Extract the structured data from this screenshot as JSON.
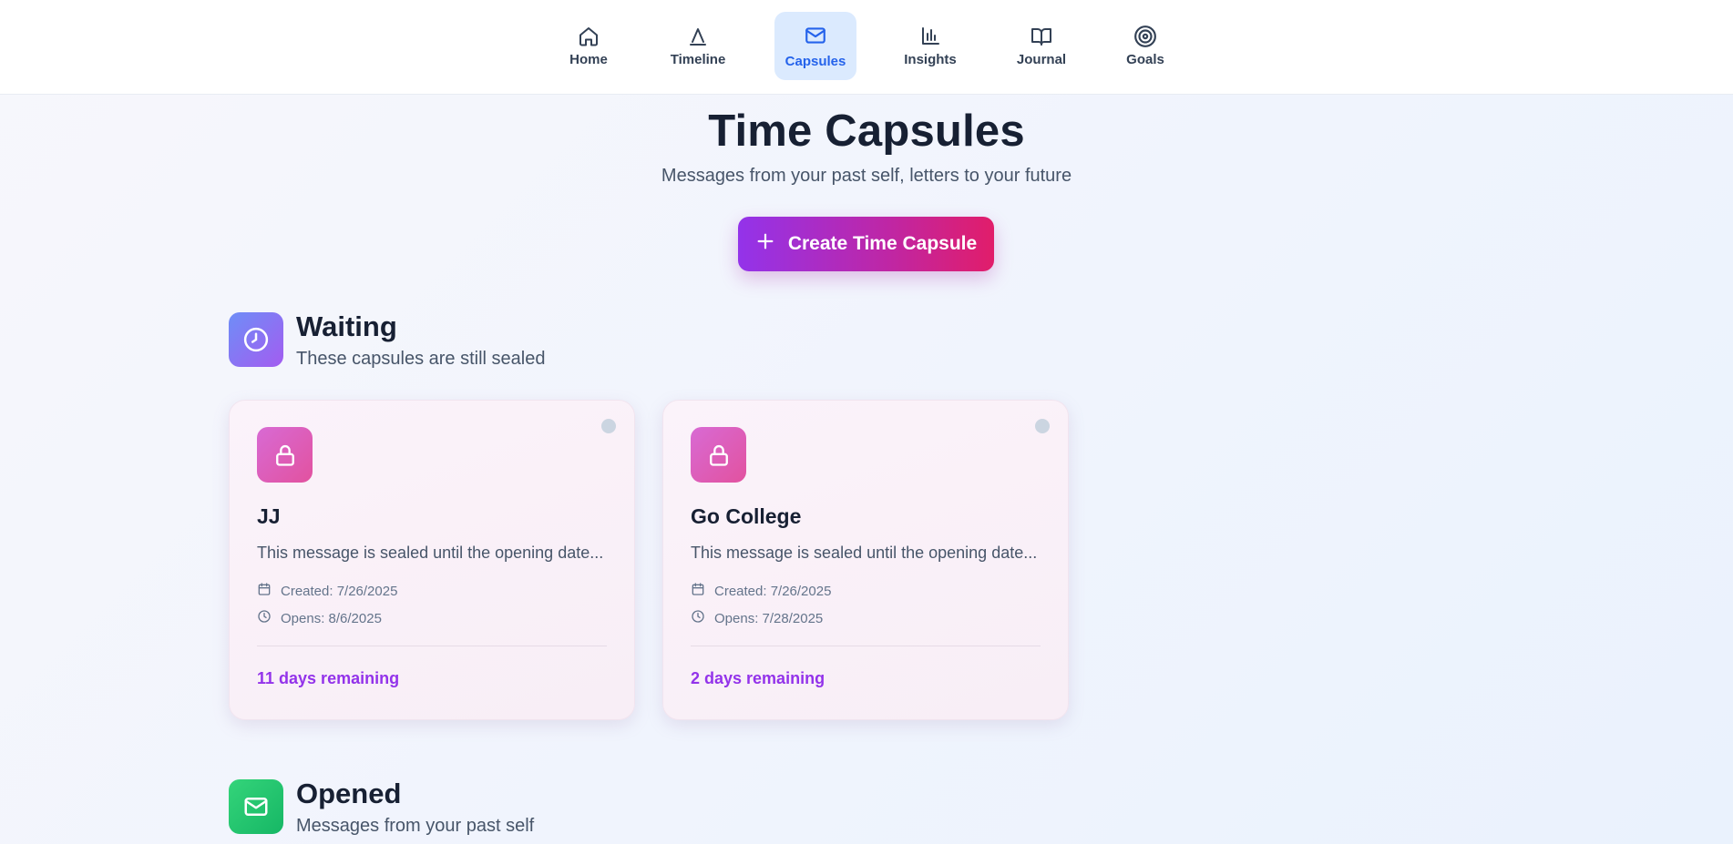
{
  "nav": {
    "items": [
      {
        "label": "Home",
        "icon": "home-icon"
      },
      {
        "label": "Timeline",
        "icon": "timeline-icon"
      },
      {
        "label": "Capsules",
        "icon": "mail-icon",
        "active": true
      },
      {
        "label": "Insights",
        "icon": "bar-chart-icon"
      },
      {
        "label": "Journal",
        "icon": "book-open-icon"
      },
      {
        "label": "Goals",
        "icon": "target-icon"
      }
    ]
  },
  "header": {
    "title": "Time Capsules",
    "subtitle": "Messages from your past self, letters to your future",
    "create_label": "Create Time Capsule"
  },
  "waiting": {
    "title": "Waiting",
    "subtitle": "These capsules are still sealed",
    "capsules": [
      {
        "title": "JJ",
        "message": "This message is sealed until the opening date...",
        "created": "Created: 7/26/2025",
        "opens": "Opens: 8/6/2025",
        "remaining": "11 days remaining"
      },
      {
        "title": "Go College",
        "message": "This message is sealed until the opening date...",
        "created": "Created: 7/26/2025",
        "opens": "Opens: 7/28/2025",
        "remaining": "2 days remaining"
      }
    ]
  },
  "opened": {
    "title": "Opened",
    "subtitle": "Messages from your past self"
  },
  "colors": {
    "accent": "#9333ea",
    "active_nav_bg": "#dbeafe",
    "active_nav_text": "#2563eb",
    "waiting_icon_gradient": [
      "#6e8ef7",
      "#a35cf0"
    ],
    "opened_icon_gradient": [
      "#34d47a",
      "#16b765"
    ],
    "lock_tile_gradient": [
      "#d86ad4",
      "#e2529f"
    ]
  }
}
